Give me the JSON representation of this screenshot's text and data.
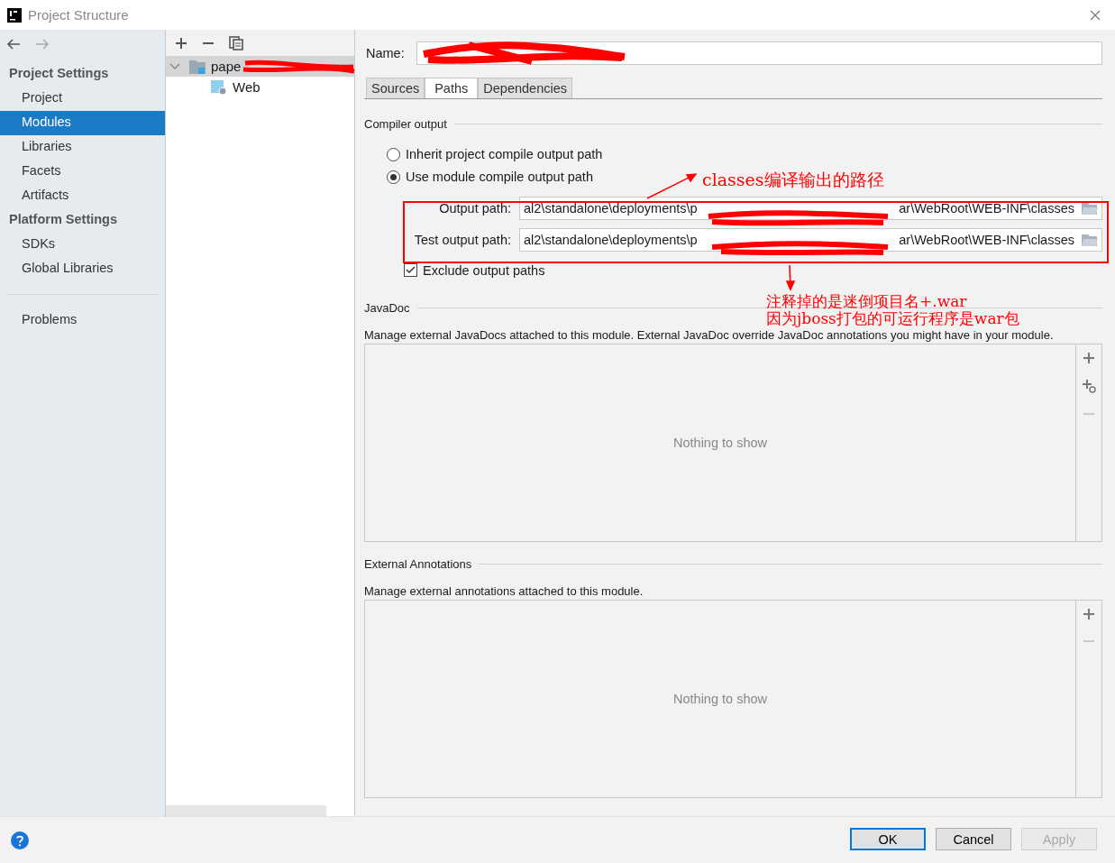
{
  "window": {
    "title": "Project Structure"
  },
  "sidebar": {
    "sections": [
      {
        "heading": "Project Settings",
        "items": [
          {
            "label": "Project",
            "selected": false
          },
          {
            "label": "Modules",
            "selected": true
          },
          {
            "label": "Libraries",
            "selected": false
          },
          {
            "label": "Facets",
            "selected": false
          },
          {
            "label": "Artifacts",
            "selected": false
          }
        ]
      },
      {
        "heading": "Platform Settings",
        "items": [
          {
            "label": "SDKs",
            "selected": false
          },
          {
            "label": "Global Libraries",
            "selected": false
          }
        ]
      }
    ],
    "bottom_items": [
      {
        "label": "Problems",
        "selected": false
      }
    ]
  },
  "module_tree": {
    "items": [
      {
        "label": "pape",
        "expanded": true,
        "selected": true,
        "children": [
          {
            "label": "Web",
            "selected": false
          }
        ]
      }
    ]
  },
  "details": {
    "name_label": "Name:",
    "tabs": [
      {
        "label": "Sources",
        "selected": false
      },
      {
        "label": "Paths",
        "selected": true
      },
      {
        "label": "Dependencies",
        "selected": false
      }
    ],
    "compiler_output": {
      "title": "Compiler output",
      "options": [
        {
          "label": "Inherit project compile output path",
          "selected": false
        },
        {
          "label": "Use module compile output path",
          "selected": true
        }
      ],
      "paths": [
        {
          "label": "Output path:",
          "value_start": "al2\\standalone\\deployments\\p",
          "value_end": "ar\\WebRoot\\WEB-INF\\classes"
        },
        {
          "label": "Test output path:",
          "value_start": "al2\\standalone\\deployments\\p",
          "value_end": "ar\\WebRoot\\WEB-INF\\classes"
        }
      ],
      "exclude": {
        "label": "Exclude output paths",
        "checked": true
      }
    },
    "javadoc": {
      "title": "JavaDoc",
      "description": "Manage external JavaDocs attached to this module. External JavaDoc override JavaDoc annotations you might have in your module.",
      "empty_text": "Nothing to show",
      "tools": [
        {
          "kind": "add"
        },
        {
          "kind": "add-url"
        },
        {
          "kind": "remove"
        }
      ]
    },
    "external_annotations": {
      "title": "External Annotations",
      "description": "Manage external annotations attached to this module.",
      "empty_text": "Nothing to show",
      "tools": [
        {
          "kind": "add"
        },
        {
          "kind": "remove"
        }
      ]
    }
  },
  "buttons": [
    {
      "label": "OK",
      "kind": "default"
    },
    {
      "label": "Cancel",
      "kind": "normal"
    },
    {
      "label": "Apply",
      "kind": "disabled"
    }
  ],
  "annotations": [
    {
      "text": "classes编译输出的路径"
    },
    {
      "text": "注释掉的是迷倒项目名+.war"
    },
    {
      "text": "因为jboss打包的可运行程序是war包"
    }
  ]
}
